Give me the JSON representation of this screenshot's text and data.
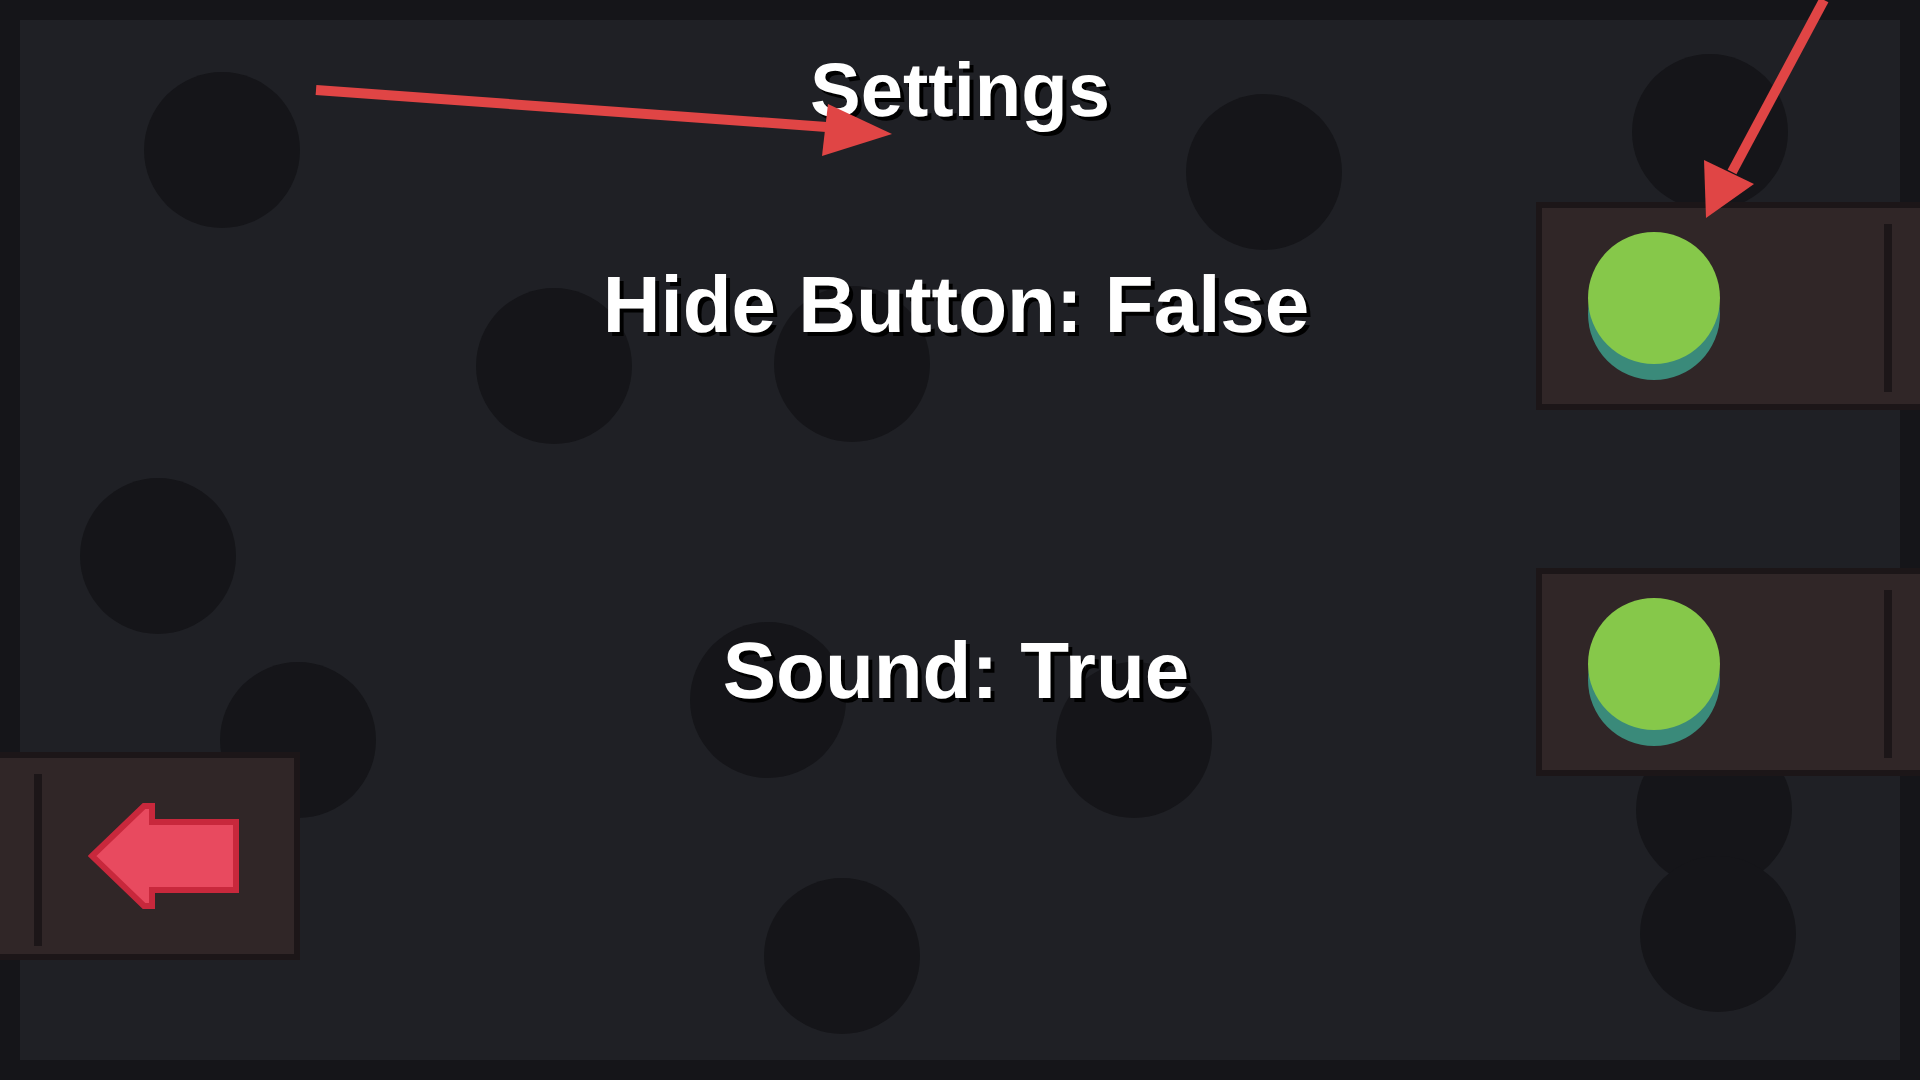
{
  "title": "Settings",
  "options": [
    {
      "label": "Hide Button: False"
    },
    {
      "label": "Sound: True"
    }
  ]
}
